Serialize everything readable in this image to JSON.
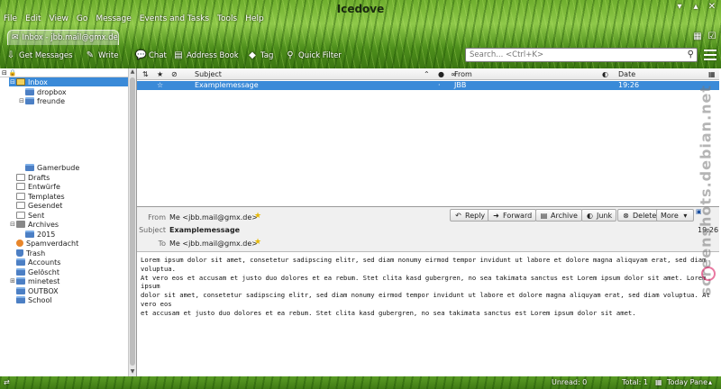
{
  "window": {
    "title": "Icedove"
  },
  "menu": [
    "File",
    "Edit",
    "View",
    "Go",
    "Message",
    "Events and Tasks",
    "Tools",
    "Help"
  ],
  "tab": {
    "label": "Inbox - jbb.mail@gmx.de"
  },
  "toolbar": {
    "get_messages": "Get Messages",
    "write": "Write",
    "chat": "Chat",
    "address_book": "Address Book",
    "tag": "Tag",
    "quick_filter": "Quick Filter",
    "search_placeholder": "Search... <Ctrl+K>"
  },
  "folders": [
    {
      "label": "Inbox",
      "selected": true
    },
    {
      "label": "dropbox"
    },
    {
      "label": "freunde"
    },
    {
      "label": "Gamerbude"
    },
    {
      "label": "Drafts"
    },
    {
      "label": "Entwürfe"
    },
    {
      "label": "Templates"
    },
    {
      "label": "Gesendet"
    },
    {
      "label": "Sent"
    },
    {
      "label": "Archives"
    },
    {
      "label": "2015"
    },
    {
      "label": "Spamverdacht"
    },
    {
      "label": "Trash"
    },
    {
      "label": "Accounts"
    },
    {
      "label": "Gelöscht"
    },
    {
      "label": "minetest"
    },
    {
      "label": "OUTBOX"
    },
    {
      "label": "School"
    }
  ],
  "columns": {
    "subject": "Subject",
    "from": "From",
    "date": "Date"
  },
  "thread": {
    "subject": "Examplemessage",
    "from": "JBB",
    "date": "19:26"
  },
  "message": {
    "from_label": "From",
    "from": "Me <jbb.mail@gmx.de>",
    "subject_label": "Subject",
    "subject": "Examplemessage",
    "to_label": "To",
    "to": "Me <jbb.mail@gmx.de>",
    "time": "19:26",
    "actions": [
      "Reply",
      "Forward",
      "Archive",
      "Junk",
      "Delete",
      "More"
    ],
    "body_lines": [
      "Lorem ipsum dolor sit amet, consetetur sadipscing elitr, sed diam nonumy eirmod tempor invidunt ut labore et dolore magna aliquyam erat, sed diam voluptua.",
      "At vero eos et accusam et justo duo dolores et ea rebum. Stet clita kasd gubergren, no sea takimata sanctus est Lorem ipsum dolor sit amet. Lorem ipsum",
      "dolor sit amet, consetetur sadipscing elitr, sed diam nonumy eirmod tempor invidunt ut labore et dolore magna aliquyam erat, sed diam voluptua. At vero eos",
      "et accusam et justo duo dolores et ea rebum. Stet clita kasd gubergren, no sea takimata sanctus est Lorem ipsum dolor sit amet."
    ]
  },
  "status": {
    "unread": "Unread: 0",
    "total": "Total: 1",
    "today_pane": "Today Pane"
  },
  "watermark": "screenshots.debian.net",
  "colors": {
    "selection": "#3a8ad8",
    "grass": "#6fae2e"
  }
}
